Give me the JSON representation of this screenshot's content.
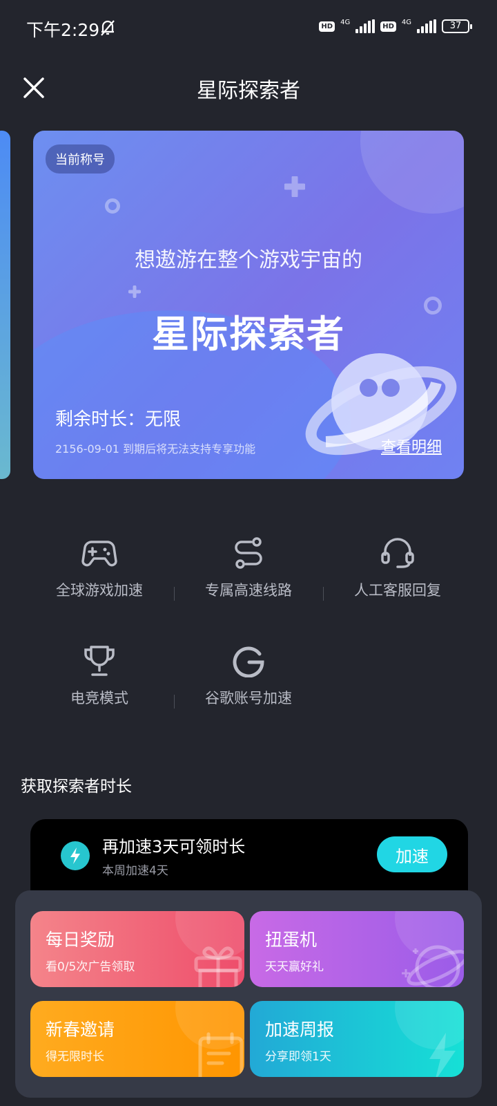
{
  "status_bar": {
    "time": "下午2:29",
    "hd1": "HD",
    "net1": "4G",
    "hd2": "HD",
    "net2": "4G",
    "battery": "37"
  },
  "header": {
    "title": "星际探索者"
  },
  "card": {
    "badge": "当前称号",
    "subtitle": "想遨游在整个游戏宇宙的",
    "title": "星际探索者",
    "remaining": "剩余时长：无限",
    "expire": "2156-09-01 到期后将无法支持专享功能",
    "detail_link": "查看明细"
  },
  "features": [
    {
      "label": "全球游戏加速",
      "icon": "gamepad-icon"
    },
    {
      "label": "专属高速线路",
      "icon": "route-icon"
    },
    {
      "label": "人工客服回复",
      "icon": "headset-icon"
    },
    {
      "label": "电竞模式",
      "icon": "trophy-icon"
    },
    {
      "label": "谷歌账号加速",
      "icon": "google-icon"
    }
  ],
  "section": {
    "title": "获取探索者时长"
  },
  "task": {
    "title": "再加速3天可领时长",
    "subtitle": "本周加速4天",
    "button": "加速"
  },
  "rewards": [
    {
      "title": "每日奖励",
      "subtitle": "看0/5次广告领取",
      "colors": [
        "#f4848a",
        "#ee4d6b"
      ]
    },
    {
      "title": "扭蛋机",
      "subtitle": "天天赢好礼",
      "colors": [
        "#c86ae6",
        "#9b5ce8"
      ]
    },
    {
      "title": "新春邀请",
      "subtitle": "得无限时长",
      "colors": [
        "#ffab1f",
        "#ff9500"
      ]
    },
    {
      "title": "加速周报",
      "subtitle": "分享即领1天",
      "colors": [
        "#22a9d6",
        "#16e0d6"
      ]
    }
  ],
  "colors": {
    "background": "#23252d",
    "accent": "#21d6e4",
    "panel": "#363a47"
  }
}
